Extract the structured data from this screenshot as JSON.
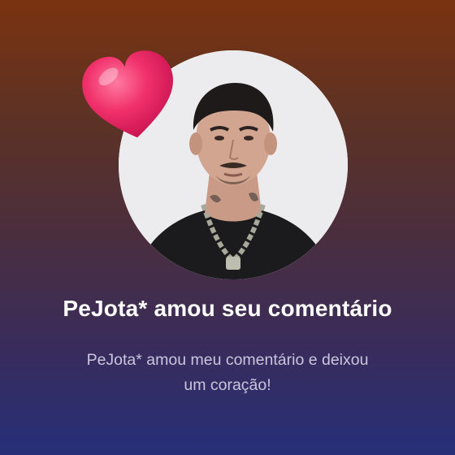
{
  "notification": {
    "title": "PeJota* amou seu comentário",
    "message_line1": "PeJota* amou meu comentário e deixou",
    "message_line2": "um coração!"
  },
  "icons": {
    "heart": "heart-icon",
    "avatar": "profile-photo"
  },
  "colors": {
    "heart": "#f0306a",
    "title": "#ffffff",
    "subtitle": "#c9c6dd",
    "background_top": "#7a3310",
    "background_bottom": "#262f78"
  }
}
